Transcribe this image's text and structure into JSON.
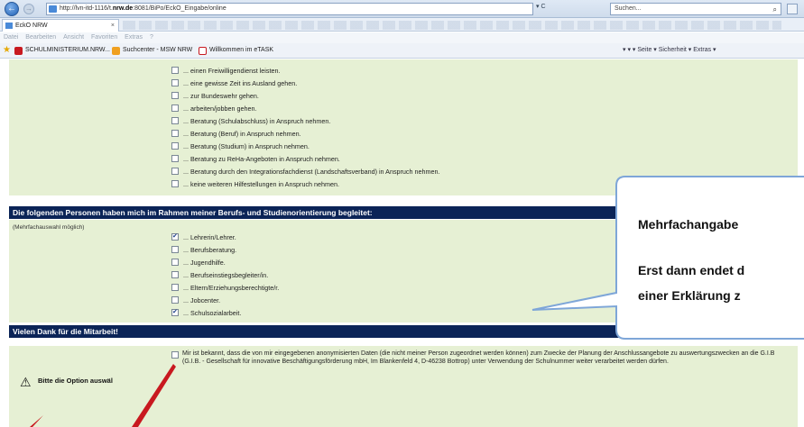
{
  "browser": {
    "address": {
      "prefix": "http://lvn-itd-1116/t.",
      "host": "nrw.de",
      "suffix": ":8081/BiPo/EckO_Eingabe/online"
    },
    "address_tools": "▾ C",
    "search_placeholder": "Suchen...",
    "tab_title": "EckO NRW",
    "menu": [
      "Datei",
      "Bearbeiten",
      "Ansicht",
      "Favoriten",
      "Extras",
      "?"
    ],
    "favorites": [
      "SCHULMINISTERIUM.NRW...",
      "Suchcenter - MSW NRW",
      "Willkommen im eTASK"
    ],
    "command_bar": "▾  ▾  ▾  Seite ▾  Sicherheit ▾  Extras ▾",
    "colors": {
      "header_navy": "#0b2457",
      "panel_green": "#e6f0d4",
      "callout_border": "#7ea6d8",
      "arrow_red": "#c8191f"
    }
  },
  "panel1": {
    "options": [
      {
        "label": "... einen Freiwilligendienst leisten.",
        "checked": false
      },
      {
        "label": "... eine gewisse Zeit ins Ausland gehen.",
        "checked": false
      },
      {
        "label": "... zur Bundeswehr gehen.",
        "checked": false
      },
      {
        "label": "... arbeiten/jobben gehen.",
        "checked": false
      },
      {
        "label": "... Beratung (Schulabschluss) in Anspruch nehmen.",
        "checked": false
      },
      {
        "label": "... Beratung (Beruf) in Anspruch nehmen.",
        "checked": false
      },
      {
        "label": "... Beratung (Studium) in Anspruch nehmen.",
        "checked": false
      },
      {
        "label": "... Beratung zu ReHa-Angeboten in Anspruch nehmen.",
        "checked": false
      },
      {
        "label": "... Beratung durch den Integrationsfachdienst (Landschaftsverband) in Anspruch nehmen.",
        "checked": false
      },
      {
        "label": "... keine weiteren Hilfestellungen in Anspruch nehmen.",
        "checked": false
      }
    ]
  },
  "section2": {
    "title": "Die folgenden Personen haben mich im Rahmen meiner Berufs- und Studienorientierung begleitet:",
    "note": "(Mehrfachauswahl möglich)",
    "options": [
      {
        "label": "... Lehrerin/Lehrer.",
        "checked": true
      },
      {
        "label": "... Berufsberatung.",
        "checked": false
      },
      {
        "label": "... Jugendhilfe.",
        "checked": false
      },
      {
        "label": "... Berufseinstiegsbegleiter/in.",
        "checked": false
      },
      {
        "label": "... Eltern/Erziehungsberechtigte/r.",
        "checked": false
      },
      {
        "label": "... Jobcenter.",
        "checked": false
      },
      {
        "label": "... Schulsozialarbeit.",
        "checked": true
      }
    ]
  },
  "section3": {
    "title": "Vielen Dank für die Mitarbeit!",
    "consent_text": "Mir ist bekannt, dass die von mir eingegebenen anonymisierten Daten (die nicht meiner Person zugeordnet werden können) zum Zwecke der Planung der Anschlussangebote zu auswertungszwecken an die G.I.B (G.I.B. - Gesellschaft für innovative Beschäftigungsförderung mbH, Im Blankenfeld 4, D-46238 Bottrop) unter Verwendung der Schulnummer weiter verarbeitet werden dürfen.",
    "consent_checked": false,
    "warning": "Bitte die Option auswäl"
  },
  "callout": {
    "line1": "Mehrfachangabe",
    "line2": "Erst dann endet d",
    "line3": "einer Erklärung z"
  }
}
